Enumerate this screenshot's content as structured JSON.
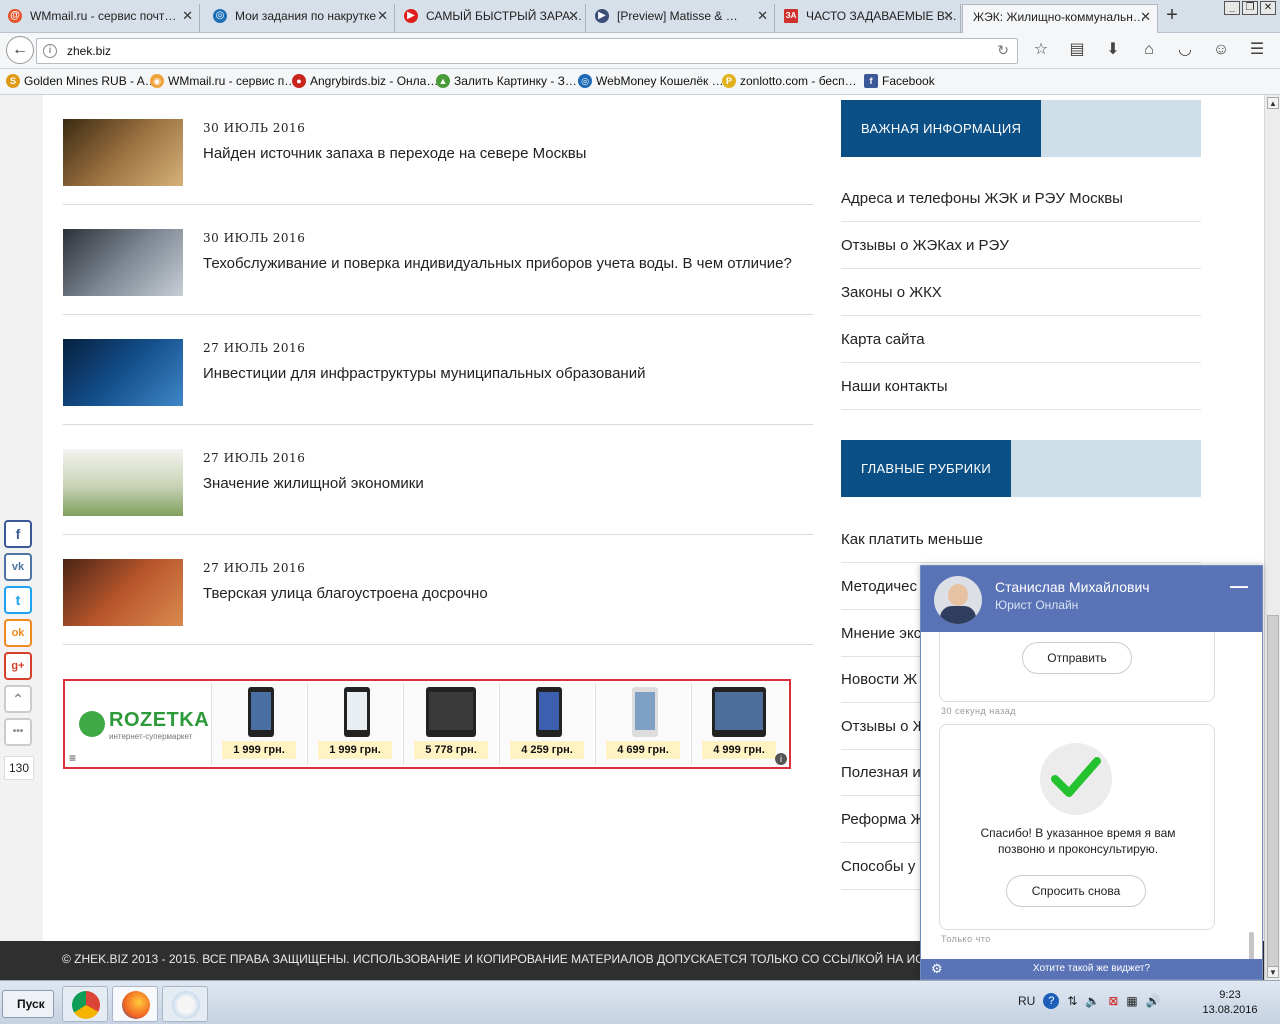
{
  "browser": {
    "tabs": [
      {
        "label": "WMmail.ru - сервис почт…",
        "icon_color": "#e8532a",
        "icon": "@"
      },
      {
        "label": "Мои задания по накрутке",
        "icon_color": "#1e6fb8",
        "icon": "◎"
      },
      {
        "label": "САМЫЙ БЫСТРЫЙ ЗАРА…",
        "icon_color": "#e01e1e",
        "icon": "▶"
      },
      {
        "label": "[Preview] Matisse & …",
        "icon_color": "#3a4e78",
        "icon": "▶"
      },
      {
        "label": "ЧАСТО ЗАДАВАЕМЫЕ В…",
        "icon_color": "#d0312d",
        "icon": "ЗА"
      },
      {
        "label": "ЖЭК: Жилищно-коммунальн…",
        "icon_color": "#7a8fb0",
        "icon": ""
      }
    ],
    "new_tab_symbol": "+",
    "url": "zhek.biz",
    "bookmarks": [
      {
        "label": "Golden Mines RUB - A…",
        "icon_color": "#e09a16",
        "icon": "S"
      },
      {
        "label": "WMmail.ru - сервис п…",
        "icon_color": "#f0a33a",
        "icon": "◉"
      },
      {
        "label": "Angrybirds.biz - Онла…",
        "icon_color": "#c9251f",
        "icon": "●"
      },
      {
        "label": "Залить Картинку - З…",
        "icon_color": "#4a9c3a",
        "icon": "▲"
      },
      {
        "label": "WebMoney Кошелёк …",
        "icon_color": "#1d6bb6",
        "icon": "◎"
      },
      {
        "label": "zonlotto.com - бесп…",
        "icon_color": "#e2b21c",
        "icon": "P"
      },
      {
        "label": "Facebook",
        "icon_color": "#3b5998",
        "icon": "f"
      }
    ]
  },
  "news": [
    {
      "date": "30 ИЮЛЬ 2016",
      "title": "Найден источник запаха в переходе на севере Москвы",
      "thumb_color": "#7a5a2e"
    },
    {
      "date": "30 ИЮЛЬ 2016",
      "title": "Техобслуживание и поверка индивидуальных приборов учета воды. В чем отличие?",
      "thumb_color": "#4d5560"
    },
    {
      "date": "27 ИЮЛЬ 2016",
      "title": "Инвестиции для инфраструктуры муниципальных образований",
      "thumb_color": "#123d6e"
    },
    {
      "date": "27 ИЮЛЬ 2016",
      "title": "Значение жилищной экономики",
      "thumb_color": "#b9c7a2"
    },
    {
      "date": "27 ИЮЛЬ 2016",
      "title": "Тверская улица благоустроена досрочно",
      "thumb_color": "#8a4a2a"
    }
  ],
  "rozetka": {
    "brand": "ROZETKA",
    "tagline": "интернет-супермаркет",
    "prices": [
      "1 999 грн.",
      "1 999 грн.",
      "5 778 грн.",
      "4 259 грн.",
      "4 699 грн.",
      "4 999 грн."
    ],
    "info": "i",
    "menu": "≡"
  },
  "sidebar": {
    "important_title": "ВАЖНАЯ ИНФОРМАЦИЯ",
    "important_links": [
      "Адреса и телефоны ЖЭК и РЭУ Москвы",
      "Отзывы о ЖЭКах и РЭУ",
      "Законы о ЖКХ",
      "Карта сайта",
      "Наши контакты"
    ],
    "rubrics_title": "ГЛАВНЫЕ РУБРИКИ",
    "rubrics_links": [
      "Как платить меньше",
      "Методичес",
      "Мнение экс",
      "Новости Ж",
      "Отзывы о Ж",
      "Полезная и",
      "Реформа Ж",
      "Способы у"
    ]
  },
  "social": {
    "buttons": [
      {
        "symbol": "f",
        "color": "#3b5998"
      },
      {
        "symbol": "vk",
        "color": "#4c75a3"
      },
      {
        "symbol": "t",
        "color": "#1da1f2"
      },
      {
        "symbol": "ok",
        "color": "#f08a1f"
      },
      {
        "symbol": "g+",
        "color": "#d6402a"
      },
      {
        "symbol": "⌃",
        "color": "#888888"
      },
      {
        "symbol": "•••",
        "color": "#888888"
      }
    ],
    "count": "130"
  },
  "footer": {
    "text": "© ZHEK.BIZ 2013 - 2015. ВСЕ ПРАВА ЗАЩИЩЕНЫ. ИСПОЛЬЗОВАНИЕ И КОПИРОВАНИЕ МАТЕРИАЛОВ ДОПУСКАЕТСЯ ТОЛЬКО СО ССЫЛКОЙ НА ИСТОЧНИК"
  },
  "chat": {
    "name": "Станислав Михайлович",
    "role": "Юрист Онлайн",
    "send_label": "Отправить",
    "stamp1": "30 секунд назад",
    "message": "Спасибо! В указанное время я вам позвоню и проконсультирую.",
    "ask_again_label": "Спросить снова",
    "stamp2": "Только что",
    "footer": "Хотите такой же виджет?",
    "minimize": "—"
  },
  "taskbar": {
    "start_label": "Пуск",
    "lang": "RU",
    "time": "9:23",
    "date": "13.08.2016"
  }
}
